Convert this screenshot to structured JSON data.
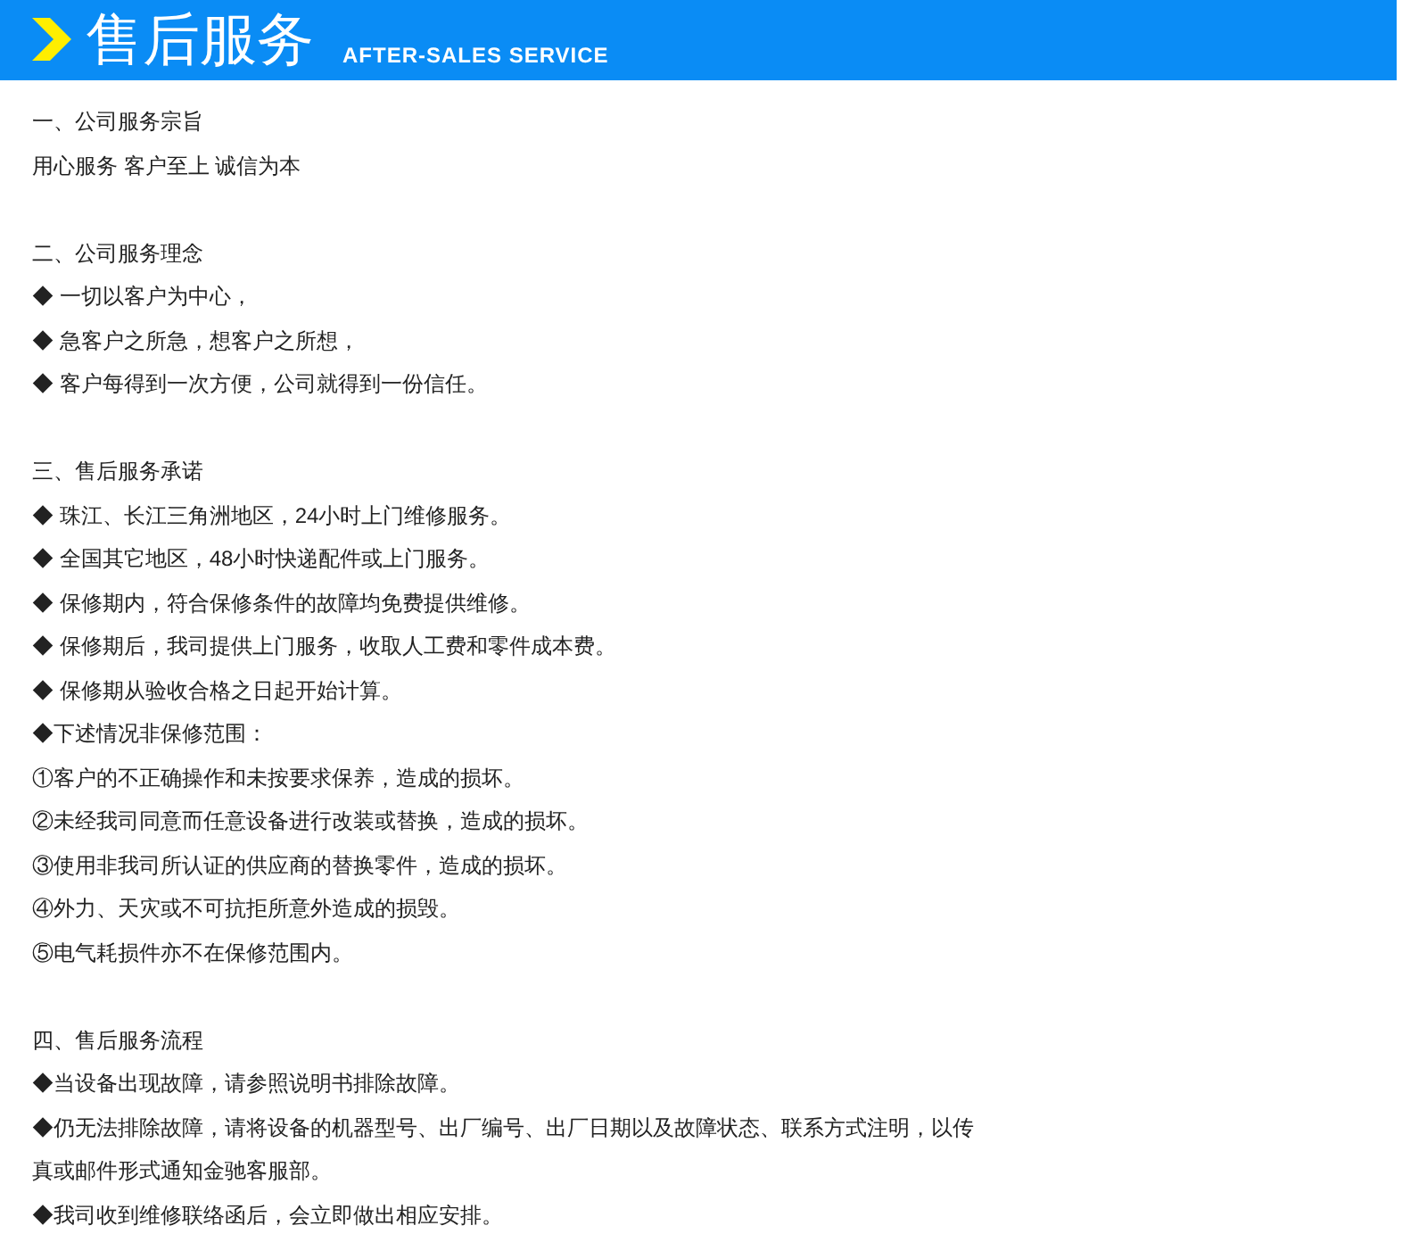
{
  "header": {
    "title": "售后服务",
    "subtitle": "AFTER-SALES SERVICE"
  },
  "sections": [
    {
      "heading": "一、公司服务宗旨",
      "lines": [
        "用心服务 客户至上 诚信为本"
      ]
    },
    {
      "heading": "二、公司服务理念",
      "lines": [
        "◆ 一切以客户为中心，",
        "◆ 急客户之所急，想客户之所想，",
        "◆ 客户每得到一次方便，公司就得到一份信任。"
      ]
    },
    {
      "heading": "三、售后服务承诺",
      "lines": [
        "◆ 珠江、长江三角洲地区，24小时上门维修服务。",
        "◆ 全国其它地区，48小时快递配件或上门服务。",
        "◆ 保修期内，符合保修条件的故障均免费提供维修。",
        "◆ 保修期后，我司提供上门服务，收取人工费和零件成本费。",
        "◆ 保修期从验收合格之日起开始计算。",
        "◆下述情况非保修范围：",
        "①客户的不正确操作和未按要求保养，造成的损坏。",
        "②未经我司同意而任意设备进行改装或替换，造成的损坏。",
        "③使用非我司所认证的供应商的替换零件，造成的损坏。",
        "④外力、天灾或不可抗拒所意外造成的损毁。",
        "⑤电气耗损件亦不在保修范围内。"
      ]
    },
    {
      "heading": "四、售后服务流程",
      "lines": [
        "◆当设备出现故障，请参照说明书排除故障。",
        "◆仍无法排除故障，请将设备的机器型号、出厂编号、出厂日期以及故障状态、联系方式注明，以传真或邮件形式通知金驰客服部。",
        "◆我司收到维修联络函后，会立即做出相应安排。"
      ]
    }
  ]
}
